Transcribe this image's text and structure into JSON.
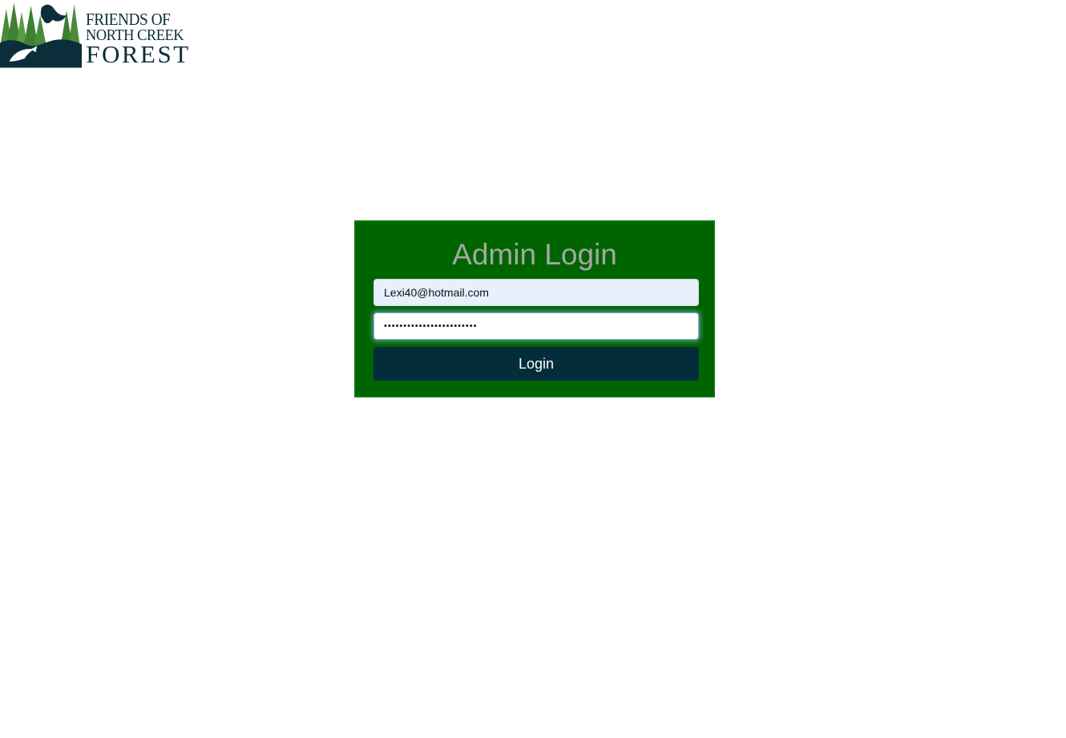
{
  "logo": {
    "line1": "FRIENDS OF",
    "line2": "NORTH CREEK",
    "line3": "FOREST",
    "icon": "forest-eagle-salmon-logo"
  },
  "login": {
    "title": "Admin Login",
    "email_value": "Lexi40@hotmail.com",
    "password_value": "••••••••••••••••••••••••",
    "button_label": "Login"
  },
  "colors": {
    "panel_bg": "#006400",
    "button_bg": "#032d3a",
    "title_text": "#a3a8a0",
    "logo_text": "#0b2f3a",
    "email_autofill_bg": "#e8f0fe"
  }
}
